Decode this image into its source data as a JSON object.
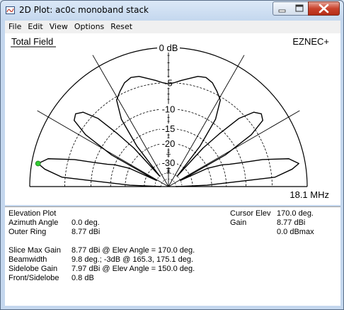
{
  "window": {
    "title": "2D Plot: ac0c monoband stack",
    "controls": {
      "minimize": "minimize",
      "maximize": "maximize",
      "close": "close"
    }
  },
  "menu": [
    "File",
    "Edit",
    "View",
    "Options",
    "Reset"
  ],
  "plot": {
    "title": "Total Field",
    "brand": "EZNEC+",
    "frequency": "18.1 MHz",
    "ring_labels": [
      "0 dB",
      "-5",
      "-10",
      "-15",
      "-20",
      "-30"
    ],
    "colors": {
      "pattern": "#000000",
      "grid": "#000000",
      "cursor": "#33cc33"
    }
  },
  "chart_data": {
    "type": "polar",
    "plot_kind": "Elevation Plot",
    "angle_range_deg": [
      0,
      180
    ],
    "ring_db": [
      0,
      -5,
      -10,
      -15,
      -20,
      -30
    ],
    "spokes_deg": [
      0,
      30,
      60,
      90,
      120,
      150,
      180
    ],
    "outer_ring_dbi": 8.77,
    "cursor_elev_deg": 170.0,
    "series": [
      {
        "points": [
          {
            "angle": 0,
            "db": -50
          },
          {
            "angle": 2,
            "db": -22
          },
          {
            "angle": 5,
            "db": -4.5
          },
          {
            "angle": 8,
            "db": -1.8
          },
          {
            "angle": 10,
            "db": -0.8
          },
          {
            "angle": 13,
            "db": -2
          },
          {
            "angle": 16,
            "db": -6
          },
          {
            "angle": 18,
            "db": -10
          },
          {
            "angle": 20,
            "db": -13
          },
          {
            "angle": 22,
            "db": -15
          },
          {
            "angle": 25,
            "db": -20
          },
          {
            "angle": 27,
            "db": -40
          },
          {
            "angle": 29,
            "db": -13
          },
          {
            "angle": 32,
            "db": -6
          },
          {
            "angle": 35,
            "db": -3.2
          },
          {
            "angle": 38,
            "db": -2.8
          },
          {
            "angle": 41,
            "db": -3.5
          },
          {
            "angle": 44,
            "db": -6
          },
          {
            "angle": 46,
            "db": -11
          },
          {
            "angle": 48,
            "db": -17
          },
          {
            "angle": 50,
            "db": -40
          },
          {
            "angle": 52,
            "db": -17
          },
          {
            "angle": 55,
            "db": -9
          },
          {
            "angle": 59,
            "db": -5.5
          },
          {
            "angle": 63,
            "db": -4.5
          },
          {
            "angle": 67,
            "db": -3.6
          },
          {
            "angle": 71,
            "db": -3.2
          },
          {
            "angle": 75,
            "db": -3.4
          },
          {
            "angle": 79,
            "db": -4
          },
          {
            "angle": 83,
            "db": -4.5
          },
          {
            "angle": 87,
            "db": -5.0
          },
          {
            "angle": 90,
            "db": -5.2
          },
          {
            "angle": 93,
            "db": -5.0
          },
          {
            "angle": 97,
            "db": -4.5
          },
          {
            "angle": 101,
            "db": -4
          },
          {
            "angle": 105,
            "db": -3.4
          },
          {
            "angle": 109,
            "db": -3.2
          },
          {
            "angle": 113,
            "db": -3.6
          },
          {
            "angle": 117,
            "db": -4.5
          },
          {
            "angle": 121,
            "db": -5.5
          },
          {
            "angle": 125,
            "db": -9
          },
          {
            "angle": 128,
            "db": -17
          },
          {
            "angle": 130,
            "db": -40
          },
          {
            "angle": 132,
            "db": -17
          },
          {
            "angle": 134,
            "db": -11
          },
          {
            "angle": 136,
            "db": -6
          },
          {
            "angle": 139,
            "db": -3.5
          },
          {
            "angle": 142,
            "db": -2.8
          },
          {
            "angle": 145,
            "db": -3.2
          },
          {
            "angle": 148,
            "db": -6
          },
          {
            "angle": 151,
            "db": -13
          },
          {
            "angle": 153,
            "db": -40
          },
          {
            "angle": 155,
            "db": -20
          },
          {
            "angle": 158,
            "db": -15
          },
          {
            "angle": 160,
            "db": -13
          },
          {
            "angle": 162,
            "db": -10
          },
          {
            "angle": 164,
            "db": -6
          },
          {
            "angle": 167,
            "db": -2
          },
          {
            "angle": 170,
            "db": -0.8
          },
          {
            "angle": 172,
            "db": -1.8
          },
          {
            "angle": 175,
            "db": -4.5
          },
          {
            "angle": 178,
            "db": -22
          },
          {
            "angle": 180,
            "db": -50
          }
        ]
      }
    ]
  },
  "info": {
    "plot_kind": "Elevation Plot",
    "azimuth_label": "Azimuth Angle",
    "azimuth_value": "0.0 deg.",
    "outer_ring_label": "Outer Ring",
    "outer_ring_value": "8.77 dBi",
    "slice_max_label": "Slice Max Gain",
    "slice_max_value": "8.77 dBi @ Elev Angle = 170.0 deg.",
    "beamwidth_label": "Beamwidth",
    "beamwidth_value": "9.8 deg.; -3dB @ 165.3, 175.1 deg.",
    "sidelobe_label": "Sidelobe Gain",
    "sidelobe_value": "7.97 dBi @ Elev Angle = 150.0 deg.",
    "front_sidelobe_label": "Front/Sidelobe",
    "front_sidelobe_value": "0.8 dB",
    "cursor_elev_label": "Cursor Elev",
    "cursor_elev_value": "170.0 deg.",
    "gain_label": "Gain",
    "gain_value": "8.77 dBi",
    "gain_rel_value": "0.0 dBmax"
  }
}
